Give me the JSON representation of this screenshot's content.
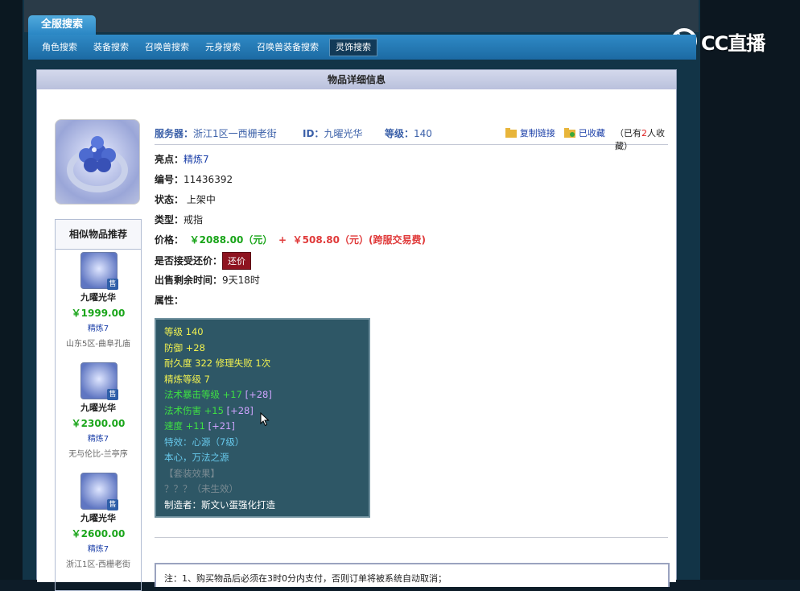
{
  "watermark": {
    "text": "CC直播"
  },
  "search_tab": {
    "label": "全服搜索"
  },
  "subnav": [
    {
      "label": "角色搜索",
      "active": false
    },
    {
      "label": "装备搜索",
      "active": false
    },
    {
      "label": "召唤兽搜索",
      "active": false
    },
    {
      "label": "元身搜索",
      "active": false
    },
    {
      "label": "召唤兽装备搜索",
      "active": false
    },
    {
      "label": "灵饰搜索",
      "active": true
    }
  ],
  "panel": {
    "title": "物品详细信息"
  },
  "similar": {
    "title": "相似物品推荐",
    "badge": "售",
    "items": [
      {
        "name": "九曜光华",
        "price": "￥1999.00",
        "tag": "精炼7",
        "server": "山东5区-曲阜孔庙"
      },
      {
        "name": "九曜光华",
        "price": "￥2300.00",
        "tag": "精炼7",
        "server": "无与伦比-兰亭序"
      },
      {
        "name": "九曜光华",
        "price": "￥2600.00",
        "tag": "精炼7",
        "server": "浙江1区-西栅老街"
      }
    ]
  },
  "info": {
    "server_label": "服务器：",
    "server_value": "浙江1区一西栅老街",
    "id_label": "ID：",
    "id_value": "九曜光华",
    "level_label": "等级：",
    "level_value": "140",
    "copy_link": "复制链接",
    "favorited": "已收藏",
    "fav_prefix": "（已有",
    "fav_count": "2",
    "fav_suffix": "人收藏）"
  },
  "details": {
    "highlight_label": "亮点：",
    "highlight_value": "精炼7",
    "number_label": "编号：",
    "number_value": "11436392",
    "status_label": "状态：",
    "status_value": "上架中",
    "type_label": "类型：",
    "type_value": "戒指",
    "price_label": "价格：",
    "price_main": "￥2088.00（元）",
    "price_plus": "+",
    "price_fee": "￥508.80（元）(跨服交易费)",
    "bargain_label": "是否接受还价：",
    "bargain_button": "还价",
    "time_label": "出售剩余时间：",
    "time_value": "9天18时",
    "attrs_label": "属性："
  },
  "attributes": [
    {
      "text": "等级 140",
      "color": "#f2f24f"
    },
    {
      "text": "防御 +28",
      "color": "#f2f24f"
    },
    {
      "text": "耐久度 322 修理失败 1次",
      "color": "#f2f24f"
    },
    {
      "text": "精炼等级 7",
      "color": "#f2f24f"
    },
    {
      "text": "法术暴击等级 +17",
      "extra": "[+28]",
      "color": "#3ee043"
    },
    {
      "text": "法术伤害 +15",
      "extra": "[+28]",
      "color": "#3ee043"
    },
    {
      "text": "速度 +11",
      "extra": "[+21]",
      "color": "#3ee043"
    },
    {
      "text": "特效：心源（7级）",
      "color": "#67c9ec"
    },
    {
      "text": "本心，万法之源",
      "color": "#67c9ec"
    },
    {
      "text": "【套装效果】",
      "color": "#7a8b93"
    },
    {
      "text": "？？？（未生效）",
      "color": "#7a8b93"
    },
    {
      "text": "制造者：斯文い蛋强化打造",
      "color": "#ffffff"
    }
  ],
  "notice": {
    "text": "注：1、购买物品后必须在3时0分内支付，否则订单将被系统自动取消；"
  }
}
